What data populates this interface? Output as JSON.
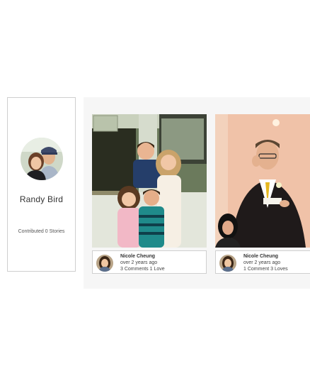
{
  "profile": {
    "name": "Randy Bird",
    "contributed_text": "Contributed 0 Stories"
  },
  "stories": [
    {
      "author": "Nicole Cheung",
      "time": "over 2 years ago",
      "stats": "3 Comments 1 Love"
    },
    {
      "author": "Nicole Cheung",
      "time": "over 2 years ago",
      "stats": "1 Comment 3 Loves"
    }
  ]
}
